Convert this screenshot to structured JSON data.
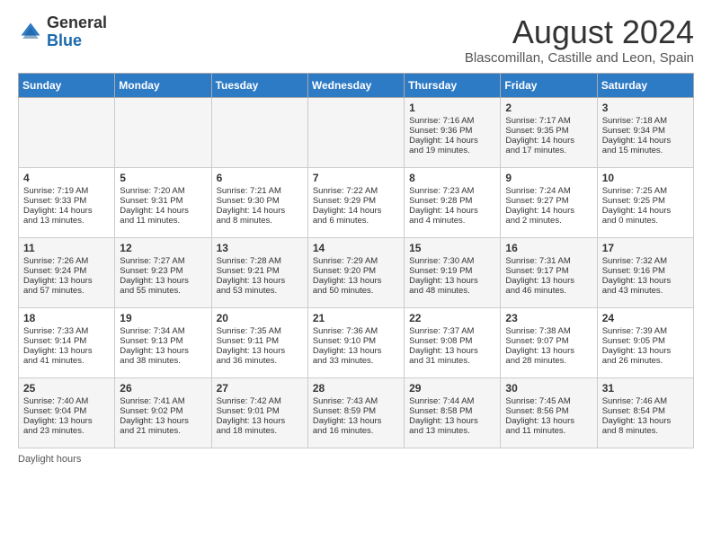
{
  "header": {
    "logo_general": "General",
    "logo_blue": "Blue",
    "month_title": "August 2024",
    "location": "Blascomillan, Castille and Leon, Spain"
  },
  "days_of_week": [
    "Sunday",
    "Monday",
    "Tuesday",
    "Wednesday",
    "Thursday",
    "Friday",
    "Saturday"
  ],
  "weeks": [
    [
      {
        "day": "",
        "info": ""
      },
      {
        "day": "",
        "info": ""
      },
      {
        "day": "",
        "info": ""
      },
      {
        "day": "",
        "info": ""
      },
      {
        "day": "1",
        "info": "Sunrise: 7:16 AM\nSunset: 9:36 PM\nDaylight: 14 hours\nand 19 minutes."
      },
      {
        "day": "2",
        "info": "Sunrise: 7:17 AM\nSunset: 9:35 PM\nDaylight: 14 hours\nand 17 minutes."
      },
      {
        "day": "3",
        "info": "Sunrise: 7:18 AM\nSunset: 9:34 PM\nDaylight: 14 hours\nand 15 minutes."
      }
    ],
    [
      {
        "day": "4",
        "info": "Sunrise: 7:19 AM\nSunset: 9:33 PM\nDaylight: 14 hours\nand 13 minutes."
      },
      {
        "day": "5",
        "info": "Sunrise: 7:20 AM\nSunset: 9:31 PM\nDaylight: 14 hours\nand 11 minutes."
      },
      {
        "day": "6",
        "info": "Sunrise: 7:21 AM\nSunset: 9:30 PM\nDaylight: 14 hours\nand 8 minutes."
      },
      {
        "day": "7",
        "info": "Sunrise: 7:22 AM\nSunset: 9:29 PM\nDaylight: 14 hours\nand 6 minutes."
      },
      {
        "day": "8",
        "info": "Sunrise: 7:23 AM\nSunset: 9:28 PM\nDaylight: 14 hours\nand 4 minutes."
      },
      {
        "day": "9",
        "info": "Sunrise: 7:24 AM\nSunset: 9:27 PM\nDaylight: 14 hours\nand 2 minutes."
      },
      {
        "day": "10",
        "info": "Sunrise: 7:25 AM\nSunset: 9:25 PM\nDaylight: 14 hours\nand 0 minutes."
      }
    ],
    [
      {
        "day": "11",
        "info": "Sunrise: 7:26 AM\nSunset: 9:24 PM\nDaylight: 13 hours\nand 57 minutes."
      },
      {
        "day": "12",
        "info": "Sunrise: 7:27 AM\nSunset: 9:23 PM\nDaylight: 13 hours\nand 55 minutes."
      },
      {
        "day": "13",
        "info": "Sunrise: 7:28 AM\nSunset: 9:21 PM\nDaylight: 13 hours\nand 53 minutes."
      },
      {
        "day": "14",
        "info": "Sunrise: 7:29 AM\nSunset: 9:20 PM\nDaylight: 13 hours\nand 50 minutes."
      },
      {
        "day": "15",
        "info": "Sunrise: 7:30 AM\nSunset: 9:19 PM\nDaylight: 13 hours\nand 48 minutes."
      },
      {
        "day": "16",
        "info": "Sunrise: 7:31 AM\nSunset: 9:17 PM\nDaylight: 13 hours\nand 46 minutes."
      },
      {
        "day": "17",
        "info": "Sunrise: 7:32 AM\nSunset: 9:16 PM\nDaylight: 13 hours\nand 43 minutes."
      }
    ],
    [
      {
        "day": "18",
        "info": "Sunrise: 7:33 AM\nSunset: 9:14 PM\nDaylight: 13 hours\nand 41 minutes."
      },
      {
        "day": "19",
        "info": "Sunrise: 7:34 AM\nSunset: 9:13 PM\nDaylight: 13 hours\nand 38 minutes."
      },
      {
        "day": "20",
        "info": "Sunrise: 7:35 AM\nSunset: 9:11 PM\nDaylight: 13 hours\nand 36 minutes."
      },
      {
        "day": "21",
        "info": "Sunrise: 7:36 AM\nSunset: 9:10 PM\nDaylight: 13 hours\nand 33 minutes."
      },
      {
        "day": "22",
        "info": "Sunrise: 7:37 AM\nSunset: 9:08 PM\nDaylight: 13 hours\nand 31 minutes."
      },
      {
        "day": "23",
        "info": "Sunrise: 7:38 AM\nSunset: 9:07 PM\nDaylight: 13 hours\nand 28 minutes."
      },
      {
        "day": "24",
        "info": "Sunrise: 7:39 AM\nSunset: 9:05 PM\nDaylight: 13 hours\nand 26 minutes."
      }
    ],
    [
      {
        "day": "25",
        "info": "Sunrise: 7:40 AM\nSunset: 9:04 PM\nDaylight: 13 hours\nand 23 minutes."
      },
      {
        "day": "26",
        "info": "Sunrise: 7:41 AM\nSunset: 9:02 PM\nDaylight: 13 hours\nand 21 minutes."
      },
      {
        "day": "27",
        "info": "Sunrise: 7:42 AM\nSunset: 9:01 PM\nDaylight: 13 hours\nand 18 minutes."
      },
      {
        "day": "28",
        "info": "Sunrise: 7:43 AM\nSunset: 8:59 PM\nDaylight: 13 hours\nand 16 minutes."
      },
      {
        "day": "29",
        "info": "Sunrise: 7:44 AM\nSunset: 8:58 PM\nDaylight: 13 hours\nand 13 minutes."
      },
      {
        "day": "30",
        "info": "Sunrise: 7:45 AM\nSunset: 8:56 PM\nDaylight: 13 hours\nand 11 minutes."
      },
      {
        "day": "31",
        "info": "Sunrise: 7:46 AM\nSunset: 8:54 PM\nDaylight: 13 hours\nand 8 minutes."
      }
    ]
  ],
  "footer": {
    "daylight_label": "Daylight hours"
  }
}
